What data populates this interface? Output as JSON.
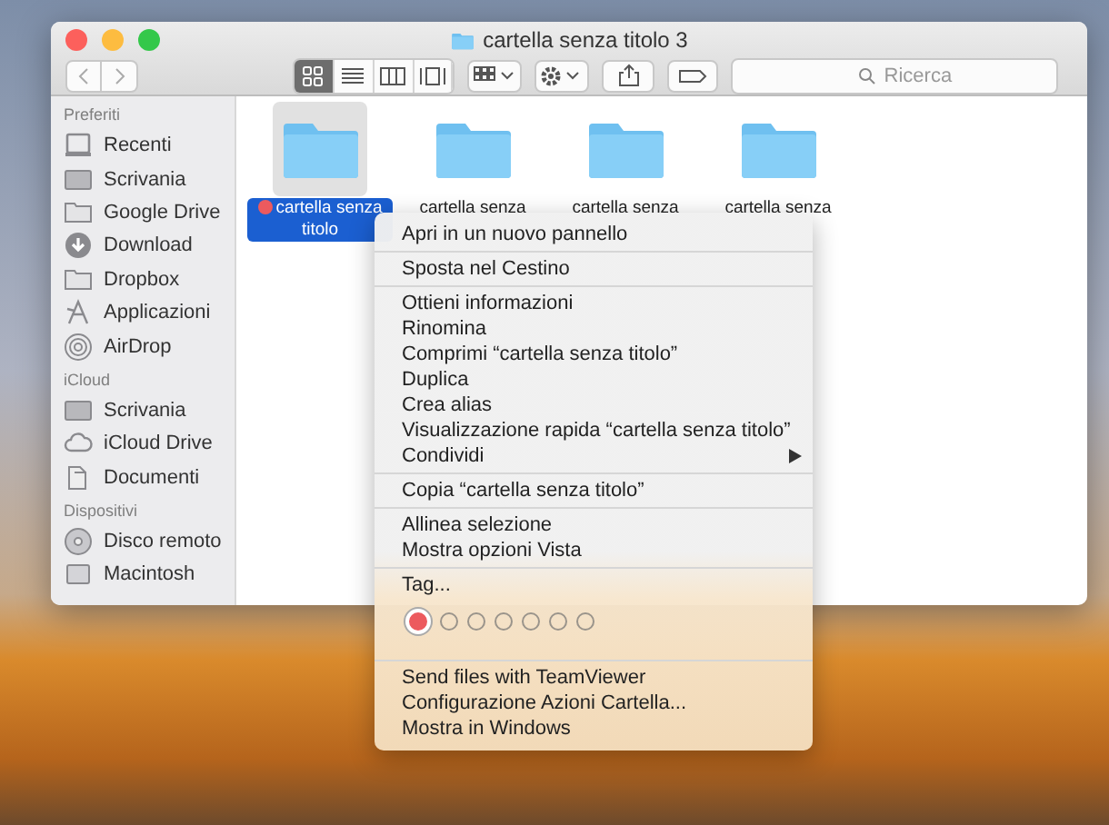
{
  "window": {
    "title": "cartella senza titolo 3"
  },
  "toolbar": {
    "view_modes": [
      {
        "kind": "icons",
        "selected": true
      },
      {
        "kind": "list",
        "selected": false
      },
      {
        "kind": "columns",
        "selected": false
      },
      {
        "kind": "gallery",
        "selected": false
      }
    ],
    "search": {
      "placeholder": "Ricerca"
    }
  },
  "sidebar": {
    "sections": [
      {
        "title": "Preferiti",
        "items": [
          {
            "label": "Recenti",
            "kind": "recents"
          },
          {
            "label": "Scrivania",
            "kind": "desktop"
          },
          {
            "label": "Google Drive",
            "kind": "folder"
          },
          {
            "label": "Download",
            "kind": "download"
          },
          {
            "label": "Dropbox",
            "kind": "folder"
          },
          {
            "label": "Applicazioni",
            "kind": "apps"
          },
          {
            "label": "AirDrop",
            "kind": "airdrop"
          }
        ]
      },
      {
        "title": "iCloud",
        "items": [
          {
            "label": "Scrivania",
            "kind": "desktop"
          },
          {
            "label": "iCloud Drive",
            "kind": "cloud"
          },
          {
            "label": "Documenti",
            "kind": "document"
          }
        ]
      },
      {
        "title": "Dispositivi",
        "items": [
          {
            "label": "Disco remoto",
            "kind": "disc"
          },
          {
            "label": "Macintosh",
            "kind": "disk"
          }
        ]
      }
    ]
  },
  "files": [
    {
      "label": "cartella senza titolo",
      "selected": true,
      "color": "#ec5a5e"
    },
    {
      "label": "cartella senza",
      "selected": false
    },
    {
      "label": "cartella senza",
      "selected": false
    },
    {
      "label": "cartella senza",
      "selected": false
    }
  ],
  "context_menu": {
    "groups": [
      {
        "items": [
          {
            "label": "Apri in un nuovo pannello"
          }
        ]
      },
      {
        "items": [
          {
            "label": "Sposta nel Cestino"
          }
        ]
      },
      {
        "items": [
          {
            "label": "Ottieni informazioni"
          },
          {
            "label": "Rinomina"
          },
          {
            "label": "Comprimi “cartella senza titolo”"
          },
          {
            "label": "Duplica"
          },
          {
            "label": "Crea alias"
          },
          {
            "label": "Visualizzazione rapida “cartella senza titolo”"
          },
          {
            "label": "Condividi",
            "submenu": true
          }
        ]
      },
      {
        "items": [
          {
            "label": "Copia “cartella senza titolo”"
          }
        ]
      },
      {
        "items": [
          {
            "label": "Allinea selezione"
          },
          {
            "label": "Mostra opzioni Vista"
          }
        ]
      },
      {
        "items": [
          {
            "label": "Tag..."
          }
        ],
        "tags": [
          {
            "color": "#ec5a5e",
            "selected": true
          },
          {
            "selected": false
          },
          {
            "selected": false
          },
          {
            "selected": false
          },
          {
            "selected": false
          },
          {
            "selected": false
          },
          {
            "selected": false
          }
        ]
      },
      {
        "items": [
          {
            "label": "Send files with TeamViewer"
          },
          {
            "label": "Configurazione Azioni Cartella..."
          },
          {
            "label": "Mostra in Windows"
          }
        ]
      }
    ]
  }
}
